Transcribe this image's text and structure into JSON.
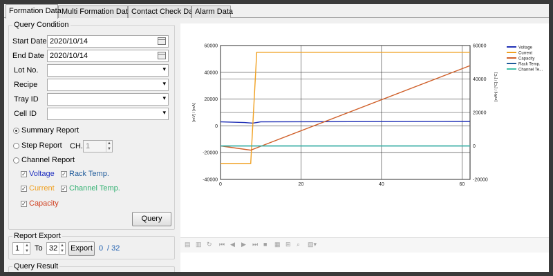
{
  "tabs": [
    "Formation Data",
    "Multi Formation Data",
    "Contact Check Data",
    "Alarm Data"
  ],
  "query": {
    "title": "Query Condition",
    "start_date_label": "Start Date",
    "start_date": "2020/10/14",
    "end_date_label": "End Date",
    "end_date": "2020/10/14",
    "lot_label": "Lot No.",
    "recipe_label": "Recipe",
    "tray_label": "Tray ID",
    "cell_label": "Cell ID",
    "summary_label": "Summary Report",
    "step_label": "Step Report",
    "ch_label": "CH.",
    "ch_value": "1",
    "channel_label": "Channel Report",
    "chk_voltage": "Voltage",
    "chk_current": "Current",
    "chk_capacity": "Capacity",
    "chk_rack": "Rack Temp.",
    "chk_channel_temp": "Channel Temp.",
    "query_button": "Query"
  },
  "export": {
    "title": "Report Export",
    "from": "1",
    "to_label": "To",
    "to": "32",
    "button": "Export",
    "progress": "0",
    "total": "/ 32"
  },
  "result": {
    "title": "Query Result"
  },
  "colors": {
    "voltage": "#1f2fb5",
    "current": "#f0a020",
    "capacity": "#d0602a",
    "rack": "#1e5a9a",
    "channel": "#40c0a8"
  },
  "icons": [
    "page-setup-icon",
    "print-icon",
    "refresh-icon",
    "first-page-icon",
    "prev-page-icon",
    "next-page-icon",
    "last-page-icon",
    "stop-icon",
    "export-icon",
    "zoom-icon",
    "find-icon",
    "layout-icon"
  ],
  "chart_data": {
    "type": "line",
    "left_axis": {
      "ticks": [
        "60000",
        "40000",
        "20000",
        "0",
        "-20000",
        "-40000"
      ],
      "range": [
        -40000,
        60000
      ],
      "label": "[mV] / [mA]"
    },
    "right_axis": {
      "ticks": [
        "60000",
        "40000",
        "20000",
        "0",
        "-20000"
      ],
      "range": [
        -20000,
        60000
      ],
      "label": "[mAh] / [°C] / [°C]"
    },
    "x_axis": {
      "ticks": [
        "0",
        "20",
        "40",
        "60"
      ],
      "range": [
        0,
        62
      ]
    },
    "series": [
      {
        "name": "Voltage",
        "axis": "left",
        "x": [
          0,
          6,
          8,
          10,
          62
        ],
        "y": [
          3000,
          2500,
          2000,
          3000,
          3300
        ]
      },
      {
        "name": "Current",
        "axis": "right",
        "x": [
          0,
          7.5,
          9,
          62
        ],
        "y": [
          -10500,
          -10500,
          56000,
          56000
        ]
      },
      {
        "name": "Capacity",
        "axis": "right",
        "x": [
          0,
          7.5,
          62
        ],
        "y": [
          0,
          -2500,
          48000
        ]
      },
      {
        "name": "Rack Temp.",
        "axis": "right",
        "x": [
          0,
          62
        ],
        "y": [
          0,
          0
        ]
      },
      {
        "name": "Channel Te...",
        "axis": "right",
        "x": [
          0,
          62
        ],
        "y": [
          0,
          0
        ]
      }
    ],
    "grid": true,
    "legend": "top-right"
  }
}
